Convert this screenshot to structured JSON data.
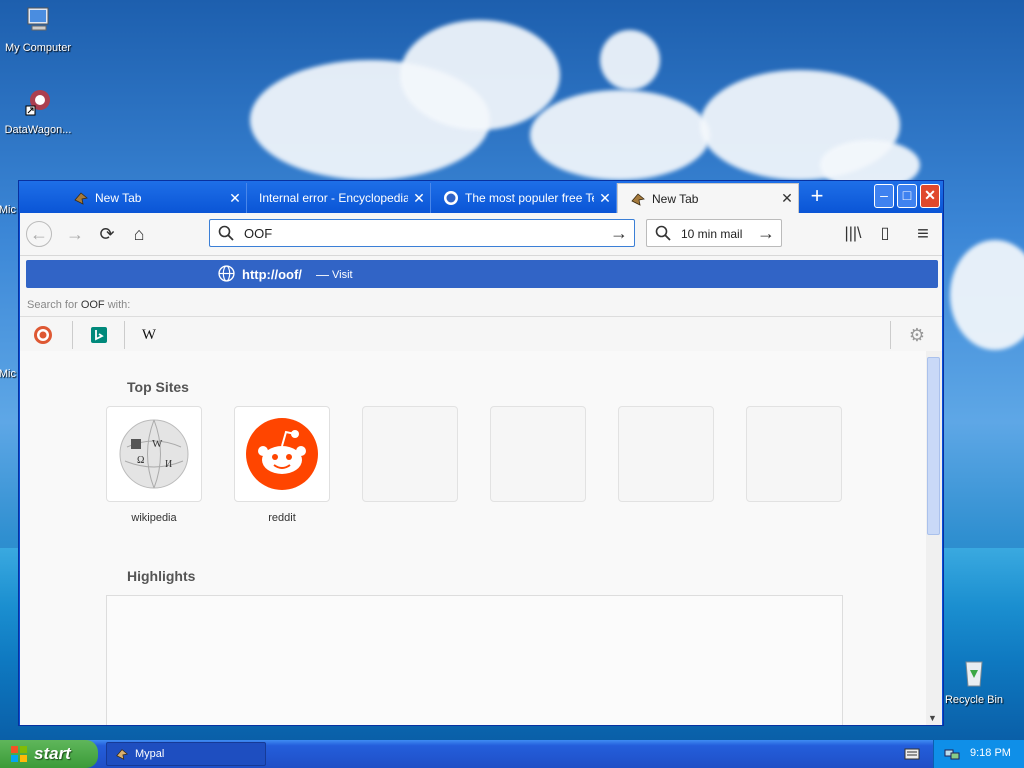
{
  "desktop": {
    "icons": [
      {
        "label": "My Computer"
      },
      {
        "label": "DataWagon..."
      },
      {
        "label": "Mic"
      },
      {
        "label": "Mic"
      },
      {
        "label": "Recycle Bin"
      }
    ]
  },
  "browser": {
    "tabs": [
      {
        "label": "New Tab",
        "icon": "mypal-icon"
      },
      {
        "label": "Internal error - Encyclopedia S",
        "icon": "none"
      },
      {
        "label": "The most populer free Ter",
        "icon": "site-icon"
      },
      {
        "label": "New Tab",
        "icon": "mypal-icon",
        "active": true
      }
    ],
    "new_tab_symbol": "+",
    "window_controls": {
      "min": "–",
      "max": "□",
      "close": "✕"
    },
    "nav": {
      "back": "←",
      "forward": "→",
      "reload": "⟳",
      "home": "⌂"
    },
    "url_value": "OOF",
    "url_go": "→",
    "search_value": "10 min mail",
    "search_go": "→",
    "tools": {
      "library": "|||\\",
      "sidebar": "▯",
      "menu": "≡"
    }
  },
  "dropdown": {
    "suggestion_url": "http://oof/",
    "suggestion_sep": "—",
    "suggestion_action": "Visit",
    "search_for_prefix": "Search for ",
    "search_for_term": "OOF",
    "search_for_suffix": " with:",
    "engines": [
      "duckduckgo-icon",
      "bing-icon",
      "wikipedia-icon"
    ],
    "wikipedia_glyph": "W",
    "settings_glyph": "⚙"
  },
  "newtab": {
    "top_sites_title": "Top Sites",
    "sites": [
      {
        "label": "wikipedia"
      },
      {
        "label": "reddit"
      },
      {
        "label": ""
      },
      {
        "label": ""
      },
      {
        "label": ""
      },
      {
        "label": ""
      }
    ],
    "highlights_title": "Highlights"
  },
  "taskbar": {
    "start_label": "start",
    "task_label": "Mypal",
    "clock": "9:18 PM"
  },
  "colors": {
    "accent": "#3164c6",
    "titlebar": "#0a55d6",
    "start": "#3b9b38"
  }
}
